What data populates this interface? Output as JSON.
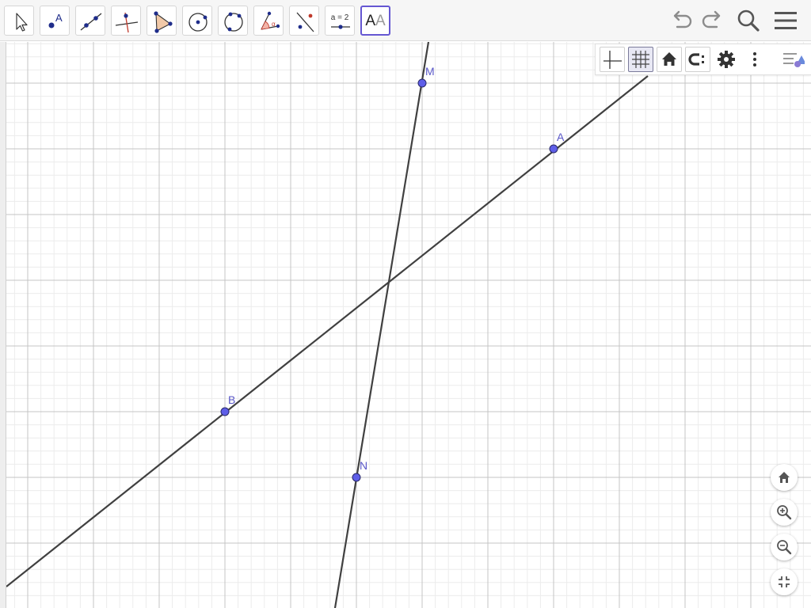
{
  "app": {
    "accent_color": "#6557d2",
    "point_color": "#5e5ee8"
  },
  "toolbar": {
    "tools": [
      {
        "id": "move",
        "icon": "move-arrow-icon"
      },
      {
        "id": "point",
        "icon": "point-icon"
      },
      {
        "id": "line",
        "icon": "line-icon"
      },
      {
        "id": "perpendicular",
        "icon": "perpendicular-line-icon"
      },
      {
        "id": "polygon",
        "icon": "polygon-icon"
      },
      {
        "id": "circle-center",
        "icon": "circle-center-point-icon"
      },
      {
        "id": "circle-three-points",
        "icon": "circle-three-points-icon"
      },
      {
        "id": "angle",
        "icon": "angle-icon"
      },
      {
        "id": "reflect",
        "icon": "reflect-about-line-icon"
      },
      {
        "id": "slider",
        "icon": "slider-icon",
        "label": "a = 2"
      },
      {
        "id": "text",
        "icon": "text-icon",
        "label_dark": "A",
        "label_light": "A",
        "selected": true
      }
    ],
    "undo_icon": "undo-icon",
    "redo_icon": "redo-icon",
    "search_icon": "search-icon",
    "menu_icon": "hamburger-menu-icon"
  },
  "stylebar": {
    "buttons": [
      "axes-toggle-icon",
      "grid-toggle-icon",
      "standard-view-icon",
      "point-capturing-icon",
      "settings-gear-icon",
      "more-vertical-icon"
    ],
    "collapse_icon": "toggle-style-bar-icon"
  },
  "zoom": {
    "buttons": [
      "home-icon",
      "zoom-in-icon",
      "zoom-out-icon",
      "exit-fullscreen-icon"
    ]
  },
  "geometry": {
    "points": [
      {
        "name": "M",
        "label": "M"
      },
      {
        "name": "A",
        "label": "A"
      },
      {
        "name": "B",
        "label": "B"
      },
      {
        "name": "N",
        "label": "N"
      }
    ],
    "lines": [
      "line-AB",
      "line-MN"
    ]
  }
}
